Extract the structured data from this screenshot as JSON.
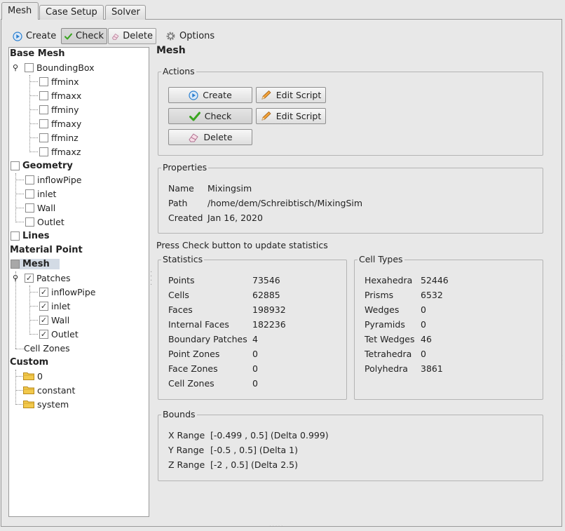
{
  "tabs": [
    {
      "label": "Mesh",
      "active": true
    },
    {
      "label": "Case Setup",
      "active": false
    },
    {
      "label": "Solver",
      "active": false
    }
  ],
  "toolbar": {
    "create": "Create",
    "check": "Check",
    "delete": "Delete",
    "options": "Options"
  },
  "tree": {
    "base_mesh": "Base Mesh",
    "bounding_box": "BoundingBox",
    "bbox_items": [
      "ffminx",
      "ffmaxx",
      "ffminy",
      "ffmaxy",
      "ffminz",
      "ffmaxz"
    ],
    "geometry": "Geometry",
    "geometry_items": [
      "inflowPipe",
      "inlet",
      "Wall",
      "Outlet"
    ],
    "lines": "Lines",
    "material_point": "Material Point",
    "mesh": "Mesh",
    "patches": "Patches",
    "patch_items": [
      "inflowPipe",
      "inlet",
      "Wall",
      "Outlet"
    ],
    "cell_zones": "Cell Zones",
    "custom": "Custom",
    "custom_items": [
      "0",
      "constant",
      "system"
    ]
  },
  "panel": {
    "title": "Mesh",
    "actions_title": "Actions",
    "create_button": "Create",
    "check_button": "Check",
    "delete_button": "Delete",
    "edit_script_1": "Edit Script",
    "edit_script_2": "Edit Script",
    "properties_title": "Properties",
    "name_label": "Name",
    "name_value": "Mixingsim",
    "path_label": "Path",
    "path_value": "/home/dem/Schreibtisch/MixingSim",
    "created_label": "Created",
    "created_value": "Jan 16, 2020",
    "note": "Press Check button to update statistics",
    "statistics_title": "Statistics",
    "statistics": [
      {
        "label": "Points",
        "value": "73546"
      },
      {
        "label": "Cells",
        "value": "62885"
      },
      {
        "label": "Faces",
        "value": "198932"
      },
      {
        "label": "Internal Faces",
        "value": "182236"
      },
      {
        "label": "Boundary Patches",
        "value": "4"
      },
      {
        "label": "Point Zones",
        "value": "0"
      },
      {
        "label": "Face Zones",
        "value": "0"
      },
      {
        "label": "Cell Zones",
        "value": "0"
      }
    ],
    "cell_types_title": "Cell Types",
    "cell_types": [
      {
        "label": "Hexahedra",
        "value": "52446"
      },
      {
        "label": "Prisms",
        "value": "6532"
      },
      {
        "label": "Wedges",
        "value": "0"
      },
      {
        "label": "Pyramids",
        "value": "0"
      },
      {
        "label": "Tet Wedges",
        "value": "46"
      },
      {
        "label": "Tetrahedra",
        "value": "0"
      },
      {
        "label": "Polyhedra",
        "value": "3861"
      }
    ],
    "bounds_title": "Bounds",
    "bounds": [
      {
        "label": "X Range",
        "value": "[-0.499 , 0.5] (Delta 0.999)"
      },
      {
        "label": "Y Range",
        "value": "[-0.5 , 0.5] (Delta 1)"
      },
      {
        "label": "Z Range",
        "value": "[-2 , 0.5] (Delta 2.5)"
      }
    ]
  },
  "colors": {
    "background": "#e8e8e8",
    "selection": "#d3dbe5",
    "check_green": "#3aa520",
    "create_blue": "#2a7fd0"
  }
}
